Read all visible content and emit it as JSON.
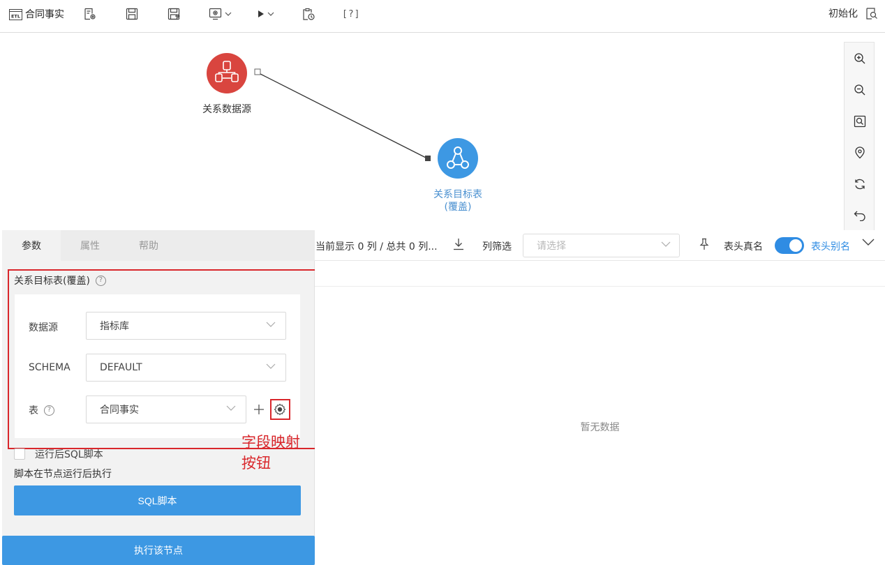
{
  "toolbar": {
    "etl_badge": "ETL",
    "title": "合同事实",
    "help_bracket": "[?]",
    "init_label": "初始化"
  },
  "canvas": {
    "source_node": {
      "label": "关系数据源",
      "color": "#d9453f"
    },
    "target_node": {
      "label_line1": "关系目标表",
      "label_line2": "(覆盖)",
      "color": "#3d98e3"
    }
  },
  "left_panel": {
    "tabs": [
      {
        "label": "参数",
        "active": true
      },
      {
        "label": "属性",
        "active": false
      },
      {
        "label": "帮助",
        "active": false
      }
    ],
    "section_title": "关系目标表(覆盖)",
    "qmark": "?",
    "form": {
      "datasource_label": "数据源",
      "datasource_value": "指标库",
      "schema_label": "SCHEMA",
      "schema_value": "DEFAULT",
      "table_label": "表",
      "table_value": "合同事实"
    },
    "annotation": "字段映射按钮",
    "checkbox_label": "运行后SQL脚本",
    "note": "脚本在节点运行后执行",
    "sql_button": "SQL脚本",
    "execute_button": "执行该节点"
  },
  "right_panel": {
    "count_text": "当前显示 0 列 / 总共 0 列...",
    "filter_label": "列筛选",
    "filter_placeholder": "请选择",
    "real_name_label": "表头真名",
    "alias_label": "表头别名",
    "toggle_on": true,
    "empty_text": "暂无数据"
  },
  "colors": {
    "accent": "#3d98e3",
    "highlight": "#d9262b"
  }
}
